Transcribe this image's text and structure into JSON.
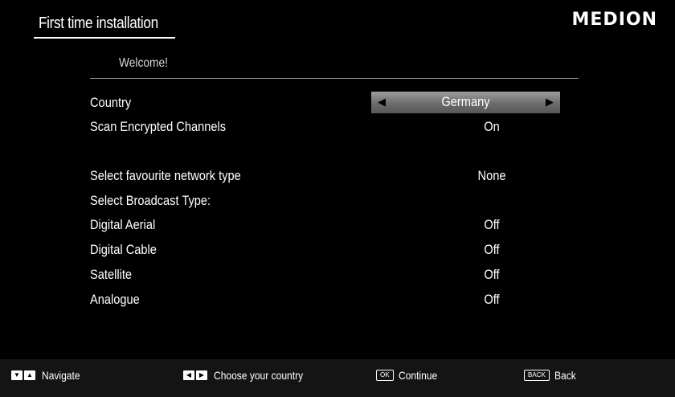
{
  "header": {
    "title": "First time installation",
    "logo": "MEDION"
  },
  "welcome": "Welcome!",
  "country": {
    "label": "Country",
    "value": "Germany"
  },
  "settings": [
    {
      "label": "Scan Encrypted Channels",
      "value": "On"
    },
    {
      "label": "Select favourite network type",
      "value": "None"
    },
    {
      "label": "Select Broadcast Type:",
      "value": ""
    },
    {
      "label": "Digital Aerial",
      "value": "Off"
    },
    {
      "label": "Digital Cable",
      "value": "Off"
    },
    {
      "label": "Satellite",
      "value": "Off"
    },
    {
      "label": "Analogue",
      "value": "Off"
    }
  ],
  "footer": {
    "navigate": {
      "keys": [
        "▼",
        "▲"
      ],
      "label": "Navigate"
    },
    "choose": {
      "keys": [
        "◀",
        "▶"
      ],
      "label": "Choose your country"
    },
    "continue": {
      "key": "OK",
      "label": "Continue"
    },
    "back": {
      "key": "BACK",
      "label": "Back"
    }
  },
  "icons": {
    "left_arrow": "left-arrow-icon",
    "right_arrow": "right-arrow-icon"
  }
}
